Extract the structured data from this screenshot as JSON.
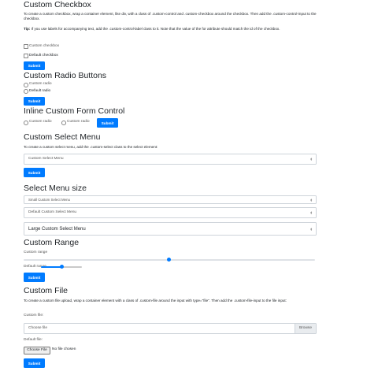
{
  "checkbox": {
    "title": "Custom Checkbox",
    "desc": "To create a custom checkbox, wrap a container element, like div, with a class of .custom-control and .custom-checkbox around the checkbox. Then add the .custom-control-input to the checkbox.",
    "tip_label": "Tip:",
    "tip_text": "If you use labels for accompanying text, add the .custom-control-label class to it. Note that the value of the for attribute should match the id of the checkbox.",
    "option1": "Custom checkbox",
    "option2": "Default checkbox",
    "submit": "Submit"
  },
  "radio": {
    "title": "Custom Radio Buttons",
    "option1": "Custom radio",
    "option2": "Default radio",
    "submit": "Submit"
  },
  "inline": {
    "title": "Inline Custom Form Control",
    "option1": "Custom radio",
    "option2": "Custom radio",
    "submit": "Submit"
  },
  "select": {
    "title": "Custom Select Menu",
    "desc": "To create a custom select menu, add the .custom-select class to the select element:",
    "value": "Custom Select Menu",
    "submit": "Submit"
  },
  "size": {
    "title": "Select Menu size",
    "small": "Small Custom Select Menu",
    "default": "Default Custom Select Menu",
    "large": "Large Custom Select Menu"
  },
  "range": {
    "title": "Custom Range",
    "label1": "Custom range",
    "value1": 0.5,
    "label2": "Default range",
    "value2": 0.5,
    "submit": "Submit"
  },
  "file": {
    "title": "Custom File",
    "desc": "To create a custom file upload, wrap a container element with a class of .custom-file around the input with type=\"file\". Then add the .custom-file-input to the file input:",
    "label1": "Custom file:",
    "placeholder": "Choose file",
    "browse": "Browse",
    "label2": "Default file:",
    "choose_button": "Choose File",
    "no_file": "No file chosen",
    "submit": "Submit"
  },
  "colors": {
    "primary": "#007bff",
    "border": "#ced4da"
  }
}
